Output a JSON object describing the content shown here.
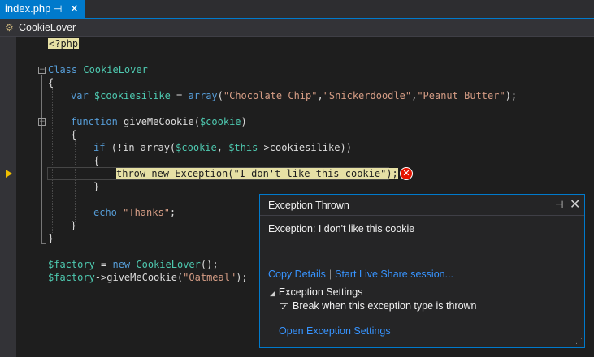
{
  "tab": {
    "title": "index.php",
    "pin": "⊣",
    "close": "✕"
  },
  "nav": {
    "class_icon": "⚙",
    "class_name": "CookieLover"
  },
  "code": {
    "l1": {
      "tag": "<?php"
    },
    "l3": {
      "kw": "Class ",
      "name": "CookieLover"
    },
    "l4": "{",
    "l5": {
      "kw": "var ",
      "var": "$cookiesilike",
      "eq": " = ",
      "fn": "array",
      "open": "(",
      "s1": "\"Chocolate Chip\"",
      "c1": ",",
      "s2": "\"Snickerdoodle\"",
      "c2": ",",
      "s3": "\"Peanut Butter\"",
      "end": ");"
    },
    "l7": {
      "kw": "function ",
      "name": "giveMeCookie(",
      "var": "$cookie",
      "end": ")"
    },
    "l8": "{",
    "l9": {
      "kw": "if ",
      "p1": "(!in_array(",
      "v1": "$cookie",
      "c": ", ",
      "v2": "$this",
      "rest": "->cookiesilike))"
    },
    "l10": "{",
    "l11": {
      "text": "throw new Exception(\"I don't like this cookie\");"
    },
    "l12": "}",
    "l14": {
      "kw": "echo ",
      "str": "\"Thanks\"",
      "end": ";"
    },
    "l15": "}",
    "l16": "}",
    "l18": {
      "var": "$factory",
      "eq": " = ",
      "kw": "new ",
      "cls": "CookieLover",
      "end": "();"
    },
    "l19": {
      "var": "$factory",
      "call": "->giveMeCookie(",
      "str": "\"Oatmeal\"",
      "end": ");"
    }
  },
  "error_icon": "✕",
  "popup": {
    "title": "Exception Thrown",
    "pin": "⊣",
    "close": "✕",
    "message": "Exception: I don't like this cookie",
    "copy_details": "Copy Details",
    "separator": "|",
    "live_share": "Start Live Share session...",
    "settings_toggle": "◢",
    "settings_label": "Exception Settings",
    "checkbox_checked": "✓",
    "checkbox_label": "Break when this exception type is thrown",
    "open_settings": "Open Exception Settings",
    "grip": "⋰"
  }
}
